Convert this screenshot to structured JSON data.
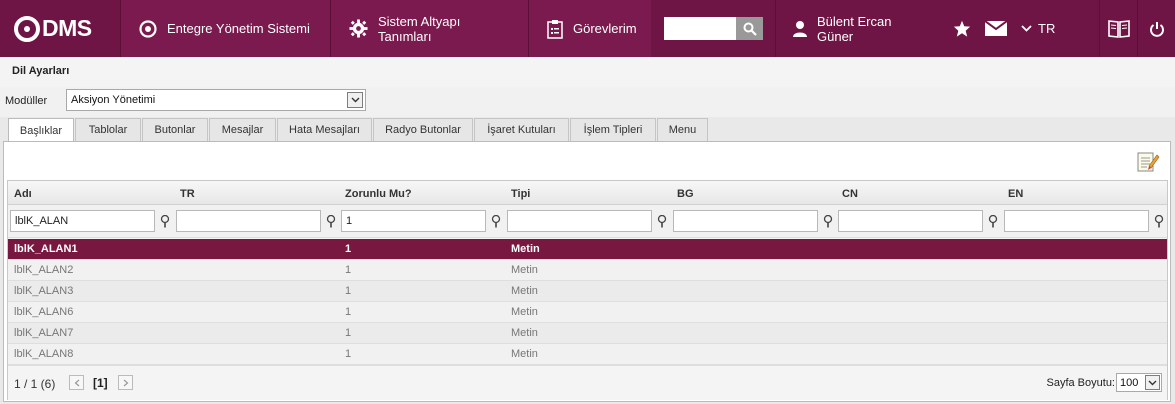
{
  "header": {
    "logo_text": "DMS",
    "nav": [
      {
        "label": "Entegre Yönetim Sistemi",
        "icon": "target-icon"
      },
      {
        "label": "Sistem Altyapı Tanımları",
        "icon": "gear-icon"
      },
      {
        "label": "Görevlerim",
        "icon": "clipboard-icon"
      }
    ],
    "search": {
      "value": "",
      "placeholder": ""
    },
    "user": "Bülent Ercan Güner",
    "language": "TR"
  },
  "page": {
    "title": "Dil Ayarları",
    "module_label": "Modüller",
    "module_value": "Aksiyon Yönetimi"
  },
  "tabs": [
    "Başlıklar",
    "Tablolar",
    "Butonlar",
    "Mesajlar",
    "Hata Mesajları",
    "Radyo Butonlar",
    "İşaret Kutuları",
    "İşlem Tipleri",
    "Menu"
  ],
  "grid": {
    "columns": [
      "Adı",
      "TR",
      "Zorunlu Mu?",
      "Tipi",
      "BG",
      "CN",
      "EN"
    ],
    "filters": [
      "lblK_ALAN",
      "",
      "1",
      "",
      "",
      "",
      ""
    ],
    "rows": [
      [
        "lblK_ALAN1",
        "",
        "1",
        "Metin",
        "",
        "",
        ""
      ],
      [
        "lblK_ALAN2",
        "",
        "1",
        "Metin",
        "",
        "",
        ""
      ],
      [
        "lblK_ALAN3",
        "",
        "1",
        "Metin",
        "",
        "",
        ""
      ],
      [
        "lblK_ALAN6",
        "",
        "1",
        "Metin",
        "",
        "",
        ""
      ],
      [
        "lblK_ALAN7",
        "",
        "1",
        "Metin",
        "",
        "",
        ""
      ],
      [
        "lblK_ALAN8",
        "",
        "1",
        "Metin",
        "",
        "",
        ""
      ]
    ],
    "selected_row": 0
  },
  "pager": {
    "info": "1 / 1 (6)",
    "current": "[1]",
    "size_label": "Sayfa Boyutu:",
    "size_value": "100"
  },
  "colors": {
    "brand": "#6e1545",
    "selected_row": "#78173f"
  }
}
